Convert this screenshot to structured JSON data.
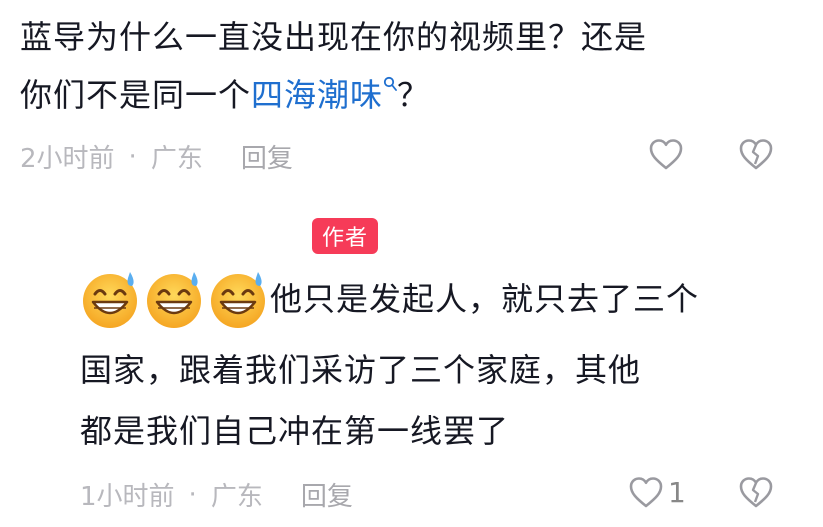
{
  "comment1": {
    "line1": "蓝导为什么一直没出现在你的视频里？还是",
    "line2_prefix": "你们不是同一个",
    "topic_link": "四海潮味",
    "line2_suffix": "？",
    "time": "2小时前",
    "separator": "·",
    "location": "广东",
    "reply_label": "回复"
  },
  "reply1": {
    "badge": "作者",
    "emojis": [
      "grinning-sweat-emoji",
      "grinning-sweat-emoji",
      "grinning-sweat-emoji"
    ],
    "line1": "他只是发起人，就只去了三个",
    "line2": "国家，跟着我们采访了三个家庭，其他",
    "line3": "都是我们自己冲在第一线罢了",
    "time": "1小时前",
    "separator": "·",
    "location": "广东",
    "reply_label": "回复",
    "like_count": "1"
  },
  "colors": {
    "link": "#1f6fcf",
    "badge": "#f63b58",
    "meta": "#b8b8bd",
    "text": "#161823"
  }
}
